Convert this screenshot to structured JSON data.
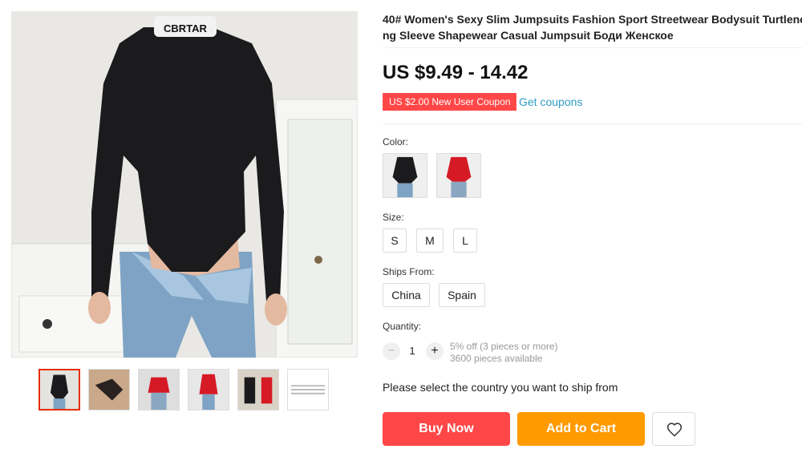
{
  "product": {
    "title_line1": "40# Women's Sexy Slim Jumpsuits Fashion Sport Streetwear Bodysuit Turtleneck Lo",
    "title_line2": "ng Sleeve Shapewear Casual Jumpsuit Боди Женское",
    "price": "US $9.49 - 14.42",
    "coupon": "US $2.00 New User Coupon",
    "get_coupons": "Get coupons"
  },
  "gallery": {
    "collar_text": "CBRTAR",
    "thumbnails": [
      {
        "name": "thumb-1",
        "color": "#1b1b1d",
        "selected": true
      },
      {
        "name": "thumb-2",
        "color": "#2a2220"
      },
      {
        "name": "thumb-3",
        "color": "#d61a25"
      },
      {
        "name": "thumb-4",
        "color": "#d61a25"
      },
      {
        "name": "thumb-5",
        "color": "#1b1b1d"
      },
      {
        "name": "thumb-6",
        "color": "#ffffff"
      }
    ]
  },
  "options": {
    "color_label": "Color:",
    "colors": [
      {
        "name": "black",
        "hex": "#1b1b1d"
      },
      {
        "name": "red",
        "hex": "#d61a25"
      }
    ],
    "size_label": "Size:",
    "sizes": [
      "S",
      "M",
      "L"
    ],
    "ships_label": "Ships From:",
    "ships_from": [
      "China",
      "Spain"
    ],
    "quantity_label": "Quantity:",
    "quantity_minus": "−",
    "quantity": "1",
    "quantity_plus": "+",
    "discount_note": "5% off (3 pieces or more)",
    "stock_note": "3600 pieces available"
  },
  "ship_message": "Please select the country you want to ship from",
  "actions": {
    "buy_now": "Buy Now",
    "add_to_cart": "Add to Cart",
    "wishlist_icon": "heart-icon"
  },
  "colors": {
    "accent_red": "#ff4747",
    "accent_orange": "#ff9a00",
    "link_blue": "#2e9cc3",
    "selected_border": "#e62e04"
  }
}
